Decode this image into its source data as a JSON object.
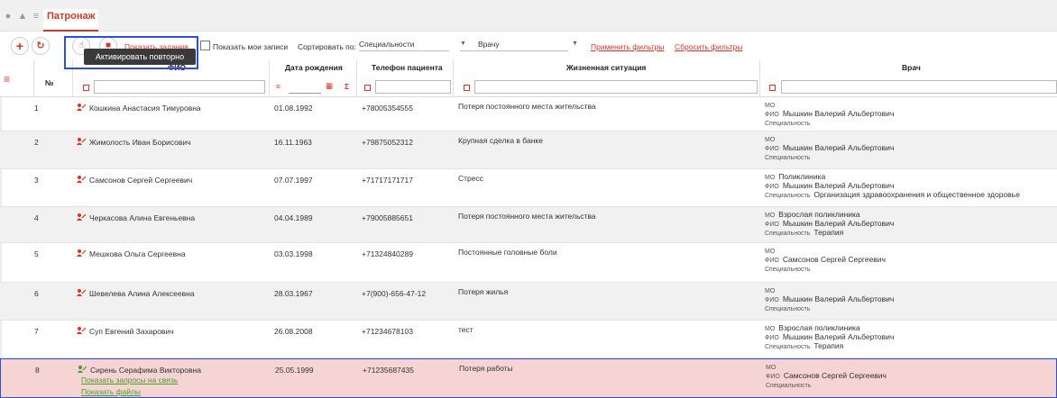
{
  "header": {
    "tab_title": "Патронаж"
  },
  "toolbar": {
    "show_tasks_link": "Показать задания",
    "show_my_records_label": "Показать мои записи",
    "sort_by_label": "Сортировать по:",
    "sort_by_value": "Специальности",
    "doctor_select_value": "Врачу",
    "apply_filters_link": "Применить фильтры",
    "reset_filters_link": "Сбросить фильтры",
    "tooltip": "Активировать повторно"
  },
  "columns": {
    "num": "№",
    "fio": "ФИО",
    "dob": "Дата рождения",
    "phone": "Телефон пациента",
    "situation": "Жизненная ситуация",
    "doctor": "Врач"
  },
  "filters": {
    "dob_op": "=",
    "sigma": "Σ"
  },
  "doc_keys": {
    "mo": "МО",
    "fio": "ФИО",
    "spec": "Специальность"
  },
  "rows": [
    {
      "num": "1",
      "name": "Кошкина Анастасия Тимуровна",
      "dob": "01.08.1992",
      "phone": "+78005354555",
      "situation": "Потеря постоянного места жительства",
      "mo": "",
      "fio": "Мышкин Валерий Альбертович",
      "spec": ""
    },
    {
      "num": "2",
      "name": "Жимолость Иван Борисович",
      "dob": "16.11.1963",
      "phone": "+79875052312",
      "situation": "Крупная сделка в банке",
      "mo": "",
      "fio": "Мышкин Валерий Альбертович",
      "spec": ""
    },
    {
      "num": "3",
      "name": "Самсонов Сергей Сергеевич",
      "dob": "07.07.1997",
      "phone": "+71717171717",
      "situation": "Стресс",
      "mo": "Поликлиника",
      "fio": "Мышкин Валерий Альбертович",
      "spec": "Организация здравоохранения и общественное здоровье"
    },
    {
      "num": "4",
      "name": "Черкасова Алина Евгеньевна",
      "dob": "04.04.1989",
      "phone": "+79005885651",
      "situation": "Потеря постоянного места жительства",
      "mo": "Взрослая поликлиника",
      "fio": "Мышкин Валерий Альбертович",
      "spec": "Терапия"
    },
    {
      "num": "5",
      "name": "Мешкова Ольга Сергеевна",
      "dob": "03.03.1998",
      "phone": "+71324840289",
      "situation": "Постоянные головные боли",
      "mo": "",
      "fio": "Самсонов Сергей Сергеевич",
      "spec": ""
    },
    {
      "num": "6",
      "name": "Шевелева Алина Алексеевна",
      "dob": "28.03.1967",
      "phone": "+7(900)-656-47-12",
      "situation": "Потеря жилья",
      "mo": "",
      "fio": "Мышкин Валерий Альбертович",
      "spec": ""
    },
    {
      "num": "7",
      "name": "Суп Евгений Захарович",
      "dob": "26.08.2008",
      "phone": "+71234678103",
      "situation": "тест",
      "mo": "Взрослая поликлиника",
      "fio": "Мышкин Валерий Альбертович",
      "spec": "Терапия"
    },
    {
      "num": "8",
      "name": "Сирень Серафима Викторовна",
      "dob": "25.05.1999",
      "phone": "+71235687435",
      "situation": "Потеря работы",
      "mo": "",
      "fio": "Самсонов Сергей Сергеевич",
      "spec": ""
    }
  ],
  "selected_row_links": {
    "show_requests": "Показать запросы на связь",
    "show_files": "Показать файлы"
  },
  "colors": {
    "accent": "#d9342b",
    "selection": "#f6d4d4",
    "highlight": "#2b4fd6",
    "patient_icon": "#d9342b",
    "patient_icon_selected": "#4a9a2e"
  }
}
